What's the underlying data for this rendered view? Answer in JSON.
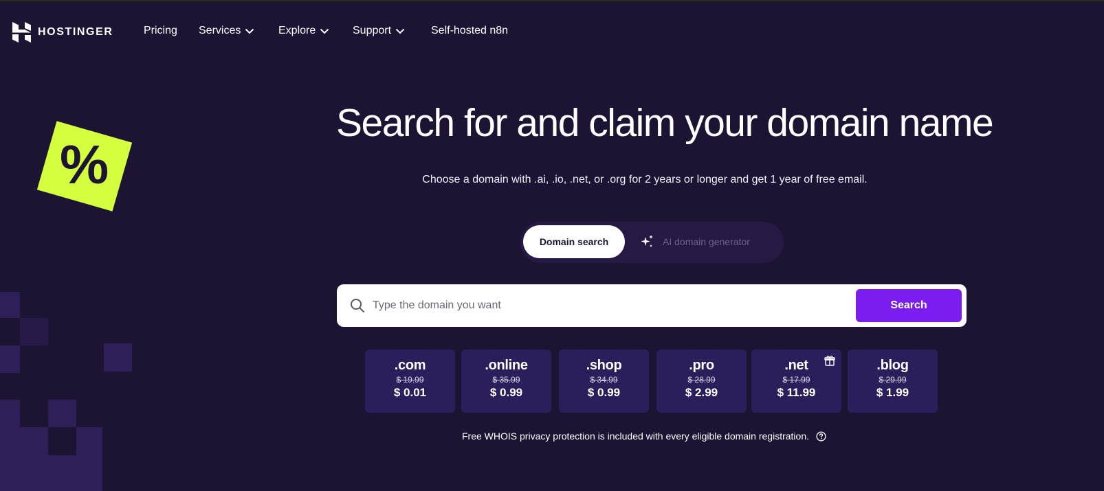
{
  "brand": {
    "name": "HOSTINGER",
    "logo_icon": "hostinger-logo-icon"
  },
  "nav": {
    "items": [
      {
        "label": "Pricing",
        "has_dropdown": false
      },
      {
        "label": "Services",
        "has_dropdown": true
      },
      {
        "label": "Explore",
        "has_dropdown": true
      },
      {
        "label": "Support",
        "has_dropdown": true
      },
      {
        "label": "Self-hosted n8n",
        "has_dropdown": false
      }
    ]
  },
  "decor": {
    "percent_tag": "%",
    "tag_color": "#d4ff3f"
  },
  "hero": {
    "title": "Search for and claim your domain name",
    "subtitle": "Choose a domain with .ai, .io, .net, or .org for 2 years or longer and get 1 year of free email."
  },
  "tabs": {
    "active": "Domain search",
    "ai": "AI domain generator",
    "ai_icon": "sparkles-icon"
  },
  "search": {
    "placeholder": "Type the domain you want",
    "value": "",
    "button": "Search",
    "accent": "#7b1df0"
  },
  "tlds": [
    {
      "name": ".com",
      "old_price": "$ 19.99",
      "price": "$ 0.01",
      "gift": false
    },
    {
      "name": ".online",
      "old_price": "$ 35.99",
      "price": "$ 0.99",
      "gift": false
    },
    {
      "name": ".shop",
      "old_price": "$ 34.99",
      "price": "$ 0.99",
      "gift": false
    },
    {
      "name": ".pro",
      "old_price": "$ 28.99",
      "price": "$ 2.99",
      "gift": false
    },
    {
      "name": ".net",
      "old_price": "$ 17.99",
      "price": "$ 11.99",
      "gift": true
    },
    {
      "name": ".blog",
      "old_price": "$ 29.99",
      "price": "$ 1.99",
      "gift": false
    }
  ],
  "whois_note": "Free WHOIS privacy protection is included with every eligible domain registration."
}
